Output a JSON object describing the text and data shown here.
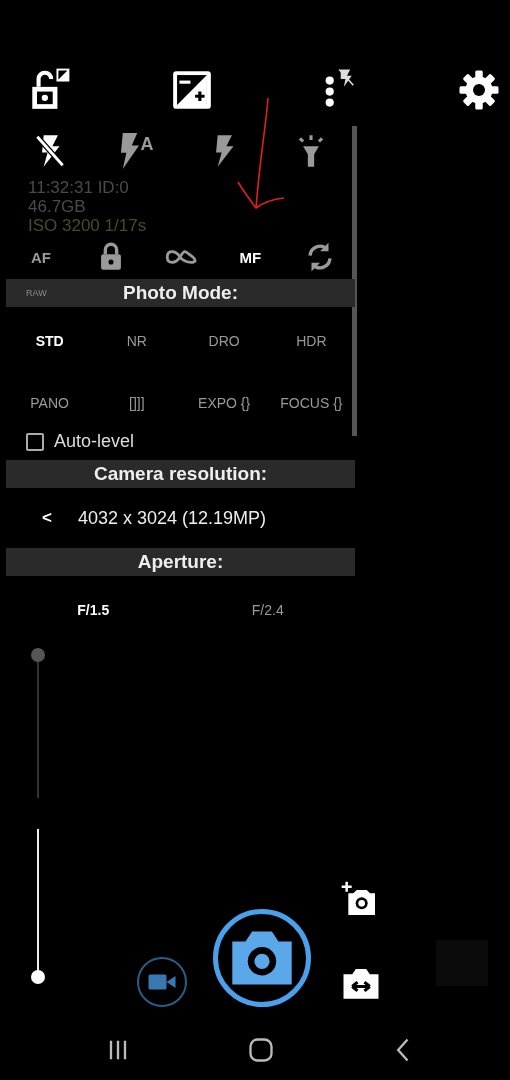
{
  "flash_modes": [
    {
      "kind": "off",
      "selected": true
    },
    {
      "kind": "auto",
      "label": "A",
      "selected": false
    },
    {
      "kind": "on",
      "selected": false
    },
    {
      "kind": "torch",
      "selected": false
    }
  ],
  "info": {
    "lines": [
      "11:32:31 ID:0",
      "46.7GB",
      "ISO 3200  1/17s"
    ]
  },
  "focus_modes": [
    {
      "kind": "text",
      "label": "AF",
      "selected": false
    },
    {
      "kind": "lock",
      "selected": false
    },
    {
      "kind": "infinity",
      "selected": false
    },
    {
      "kind": "text",
      "label": "MF",
      "selected": true
    },
    {
      "kind": "continuous",
      "selected": false
    }
  ],
  "photo_mode": {
    "title": "Photo Mode:",
    "badge": "RAW",
    "modes": [
      {
        "label": "STD",
        "selected": true
      },
      {
        "label": "NR",
        "selected": false
      },
      {
        "label": "DRO",
        "selected": false
      },
      {
        "label": "HDR",
        "selected": false
      },
      {
        "label": "PANO",
        "selected": false
      },
      {
        "label": "[]]]",
        "selected": false
      },
      {
        "label": "EXPO {}",
        "selected": false
      },
      {
        "label": "FOCUS {}",
        "selected": false
      }
    ],
    "auto_level": {
      "label": "Auto-level",
      "checked": false
    }
  },
  "camera_resolution": {
    "title": "Camera resolution:",
    "previous": "<",
    "value": "4032 x 3024 (12.19MP)"
  },
  "aperture": {
    "title": "Aperture:",
    "options": [
      {
        "label": "F/1.5",
        "selected": true
      },
      {
        "label": "F/2.4",
        "selected": false
      }
    ]
  },
  "focus_slider": {
    "level": 1
  },
  "zoom_slider": {
    "level": 0
  }
}
